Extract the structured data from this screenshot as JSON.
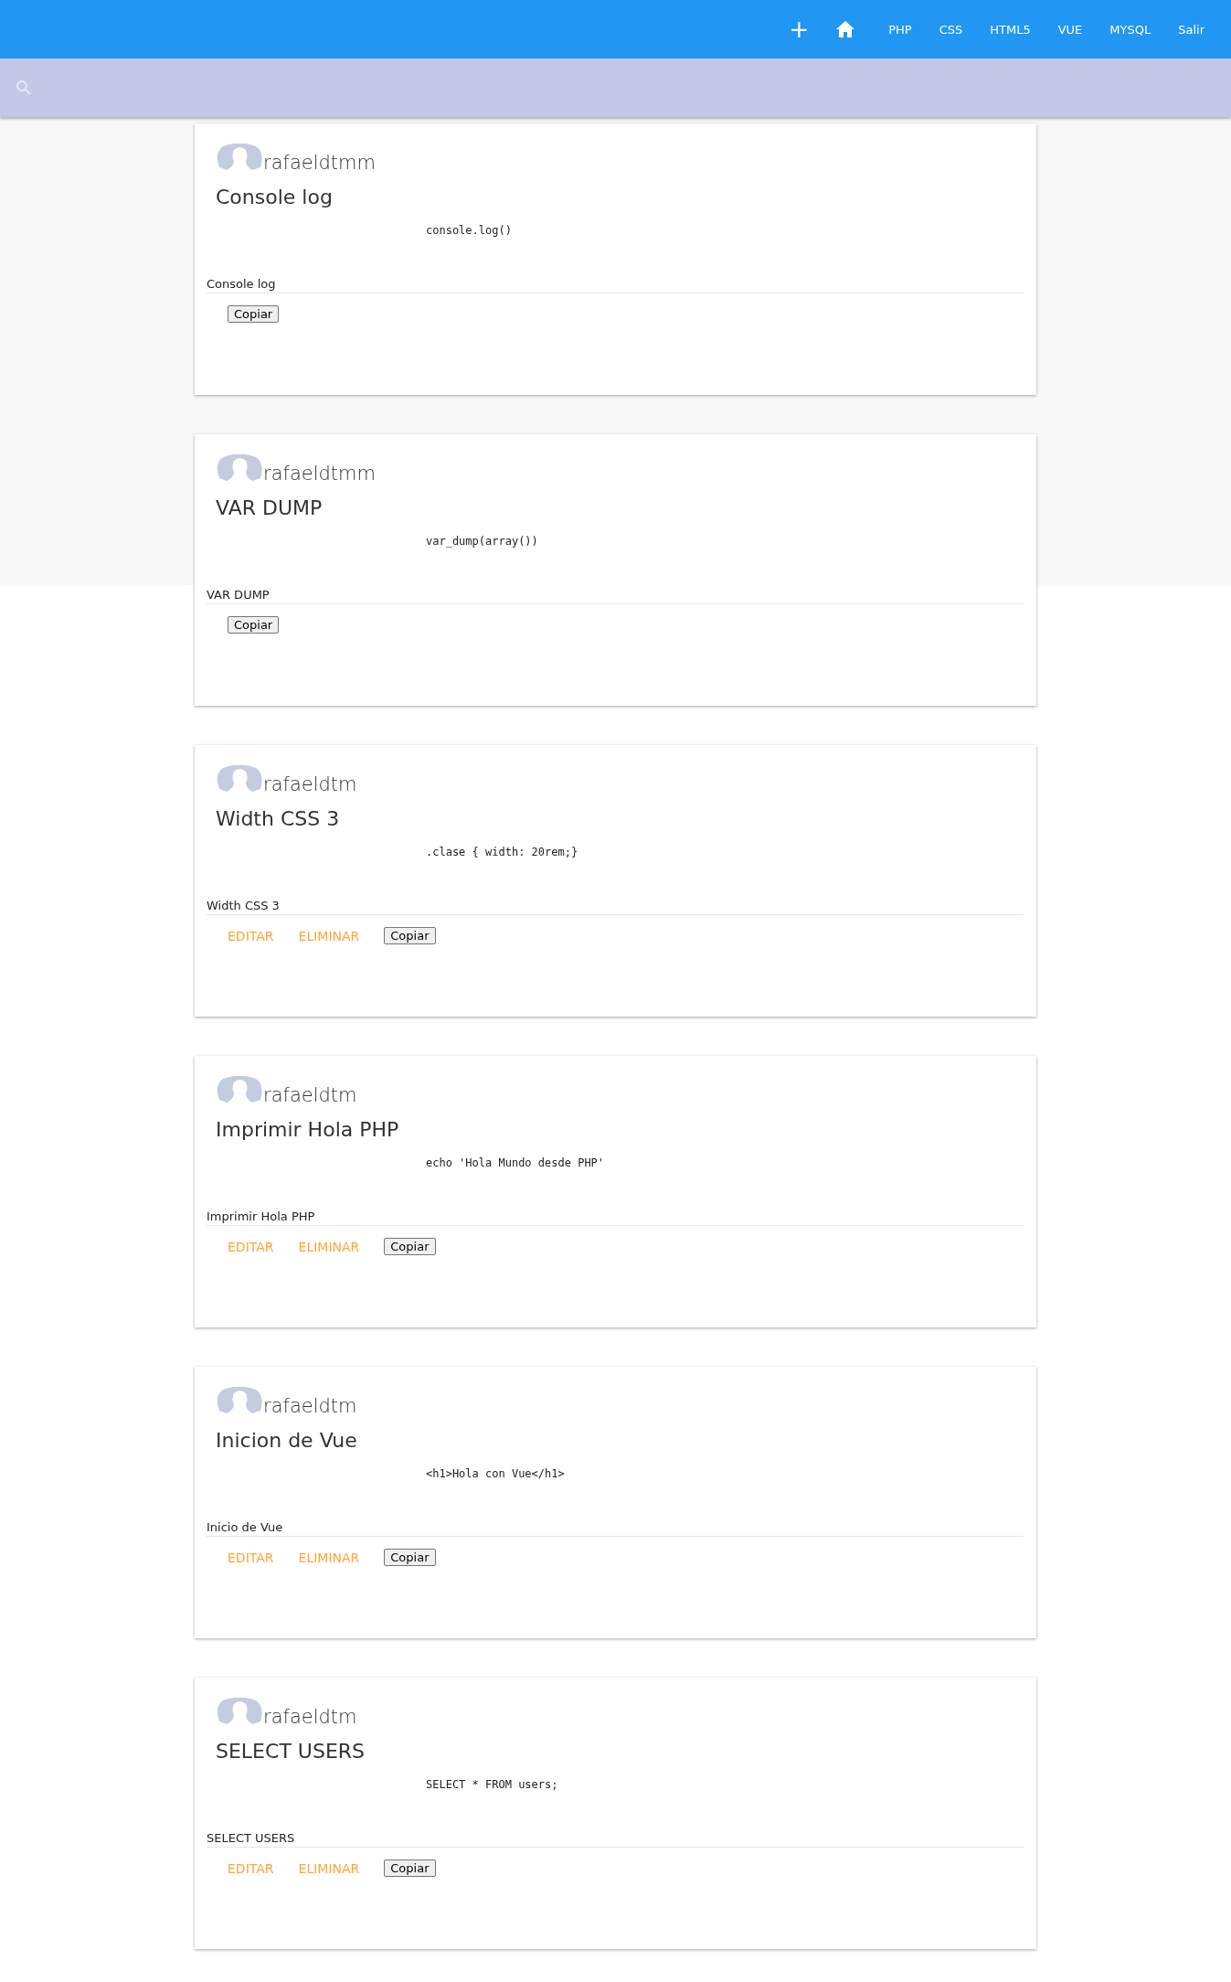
{
  "nav": {
    "add": "+",
    "links": [
      "PHP",
      "CSS",
      "HTML5",
      "VUE",
      "MYSQL",
      "Salir"
    ]
  },
  "cards": [
    {
      "user": "rafaeldtmm",
      "title": "Console log",
      "code": "console.log()",
      "description": "Console log",
      "copy": "Copiar"
    },
    {
      "user": "rafaeldtmm",
      "title": "VAR DUMP",
      "code": "var_dump(array())",
      "description": "VAR DUMP",
      "copy": "Copiar"
    },
    {
      "user": "rafaeldtm",
      "title": "Width CSS 3",
      "code": ".clase { width: 20rem;}",
      "description": "Width CSS 3",
      "actions": [
        "EDITAR",
        "ELIMINAR"
      ],
      "copy": "Copiar"
    },
    {
      "user": "rafaeldtm",
      "title": "Imprimir Hola PHP",
      "code": "echo 'Hola Mundo desde PHP'",
      "description": "Imprimir Hola PHP",
      "actions": [
        "EDITAR",
        "ELIMINAR"
      ],
      "copy": "Copiar"
    },
    {
      "user": "rafaeldtm",
      "title": "Inicion de Vue",
      "code": "<h1>Hola con Vue</h1>",
      "description": "Inicio de Vue",
      "actions": [
        "EDITAR",
        "ELIMINAR"
      ],
      "copy": "Copiar"
    },
    {
      "user": "rafaeldtm",
      "title": "SELECT USERS",
      "code": "SELECT * FROM users;",
      "description": "SELECT USERS",
      "actions": [
        "EDITAR",
        "ELIMINAR"
      ],
      "copy": "Copiar"
    }
  ]
}
